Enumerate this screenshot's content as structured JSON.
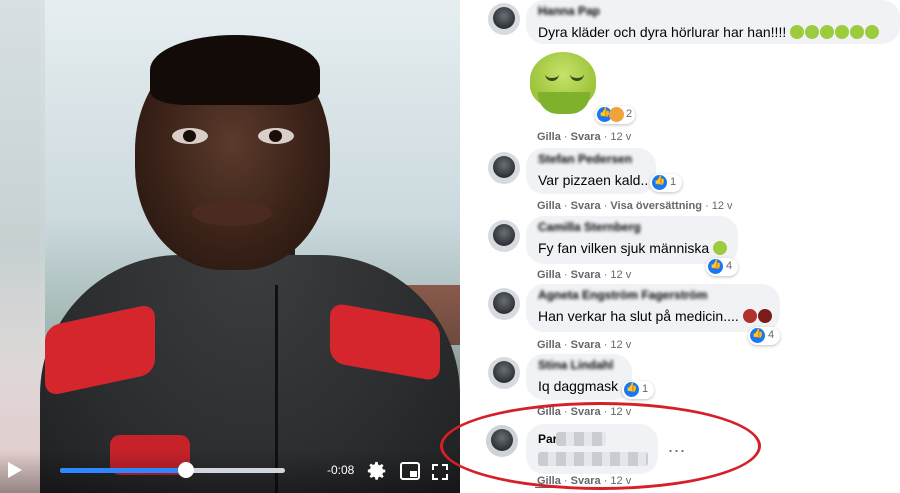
{
  "video": {
    "time_remaining": "-0:08",
    "progress": 0.56,
    "controls": [
      "play-icon",
      "gear-icon",
      "pip-icon",
      "fullscreen-icon"
    ]
  },
  "comments": [
    {
      "name": "Hanna Pap",
      "text": "Dyra kläder och dyra hörlurar har han!!!!",
      "reactions_count": "2",
      "actions": {
        "like": "Gilla",
        "reply": "Svara",
        "age": "12 v"
      }
    },
    {
      "name": "Stefan Pedersen",
      "text": "Var pizzaen kald..",
      "reactions_count": "1",
      "actions": {
        "like": "Gilla",
        "reply": "Svara",
        "translate": "Visa översättning",
        "age": "12 v"
      }
    },
    {
      "name": "Camilla Sternberg",
      "text": "Fy fan vilken sjuk människa",
      "reactions_count": "4",
      "actions": {
        "like": "Gilla",
        "reply": "Svara",
        "age": "12 v"
      }
    },
    {
      "name": "Agneta Engström Fagerström",
      "text": "Han verkar ha slut på medicin....",
      "reactions_count": "4",
      "actions": {
        "like": "Gilla",
        "reply": "Svara",
        "age": "12 v"
      }
    },
    {
      "name": "Stina Lindahl",
      "text": "Iq daggmask",
      "reactions_count": "1",
      "actions": {
        "like": "Gilla",
        "reply": "Svara",
        "age": "12 v"
      }
    },
    {
      "name": "Par",
      "text": "",
      "more": "...",
      "actions": {
        "like": "Gilla",
        "reply": "Svara",
        "age": "12 v"
      }
    }
  ],
  "separator": "·",
  "colors": {
    "accent": "#1877f2",
    "highlight": "#d61f26",
    "bubble": "#f0f2f5"
  }
}
